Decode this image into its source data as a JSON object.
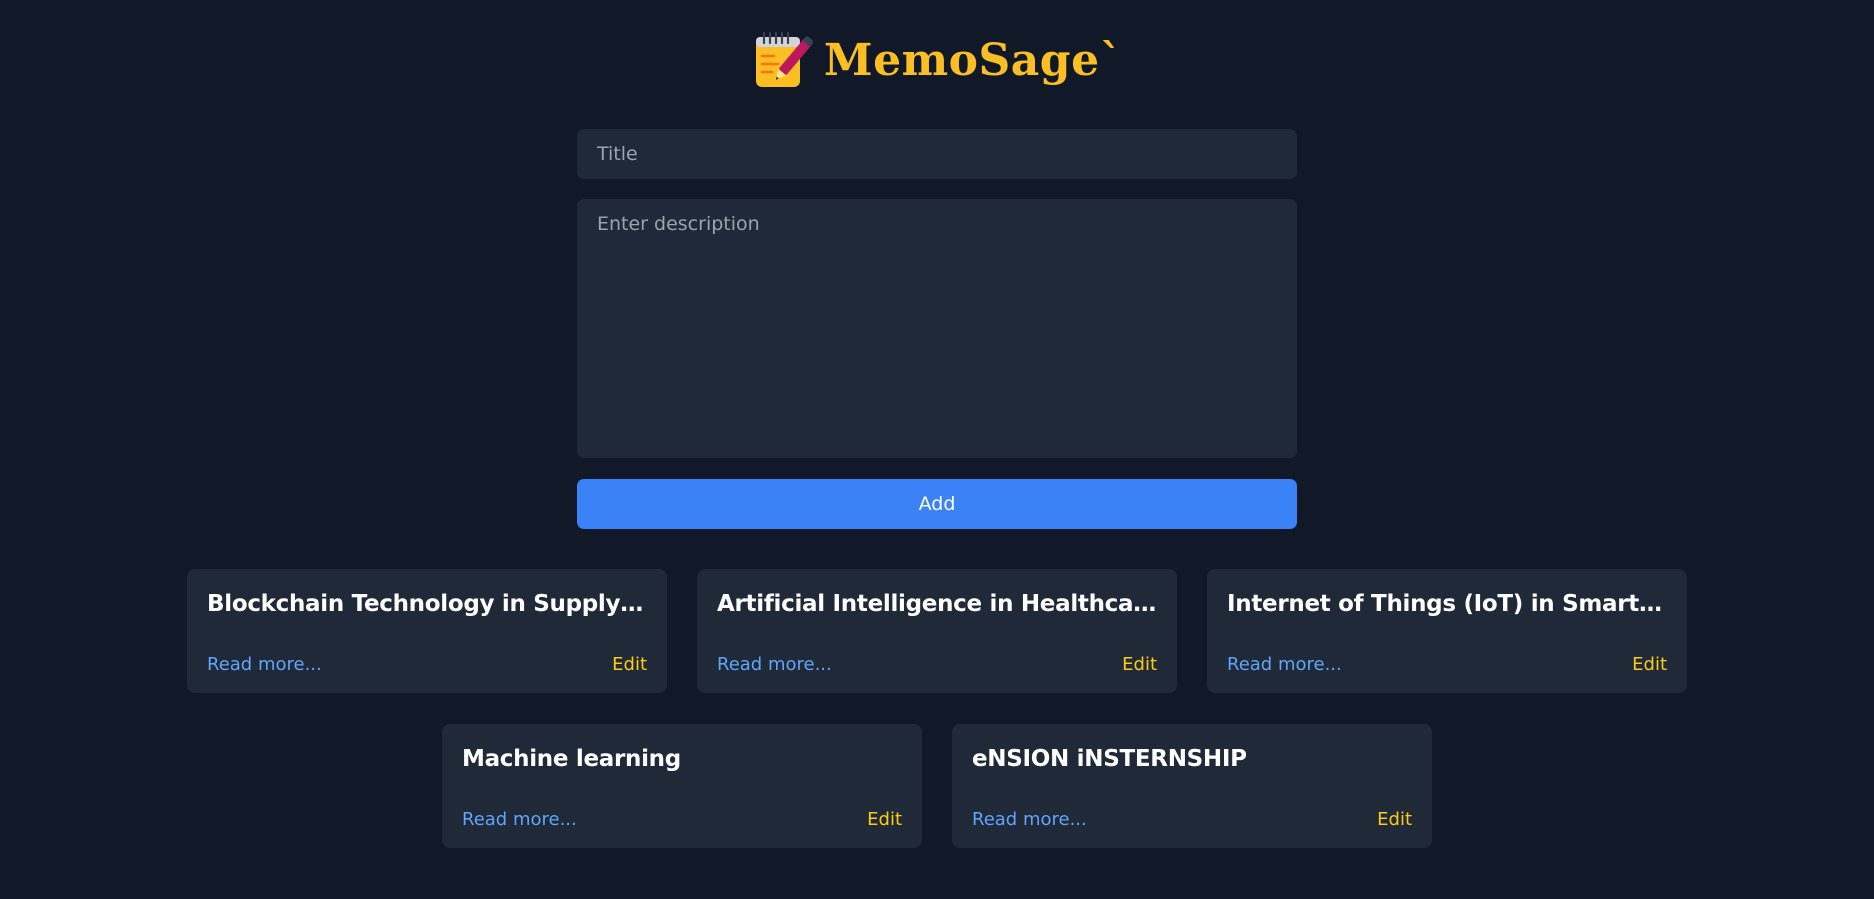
{
  "header": {
    "title": "MemoSage`",
    "logo_icon": "memo-pencil-icon"
  },
  "form": {
    "title_placeholder": "Title",
    "title_value": "",
    "description_placeholder": "Enter description",
    "description_value": "",
    "add_label": "Add"
  },
  "notes": [
    {
      "title": "Blockchain Technology in Supply Chain Management",
      "read_more": "Read more...",
      "edit": "Edit"
    },
    {
      "title": "Artificial Intelligence in Healthcare",
      "read_more": "Read more...",
      "edit": "Edit"
    },
    {
      "title": "Internet of Things (IoT) in Smart Cities",
      "read_more": "Read more...",
      "edit": "Edit"
    },
    {
      "title": "Machine learning",
      "read_more": "Read more...",
      "edit": "Edit"
    },
    {
      "title": "eNSION iNSTERNSHIP",
      "read_more": "Read more...",
      "edit": "Edit"
    }
  ],
  "colors": {
    "background": "#111827",
    "card": "#1f2937",
    "accent": "#3b82f6",
    "title": "#fbbf24",
    "link": "#60a5fa",
    "edit": "#facc15"
  }
}
